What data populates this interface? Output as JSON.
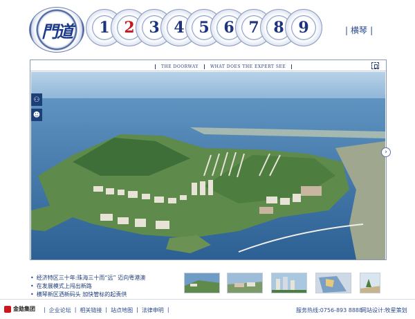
{
  "header": {
    "logo_text": "門道",
    "chapters": [
      "1",
      "2",
      "3",
      "4",
      "5",
      "6",
      "7",
      "8",
      "9"
    ],
    "active_chapter": "2",
    "link_label": "横琴",
    "link_separator": "|"
  },
  "viewer": {
    "title_left": "THE DOORWAY",
    "title_right": "WHAT DOES THE EXPERT SEE",
    "side_icons": [
      "person-walking-icon",
      "person-icon"
    ],
    "next_icon": "chevron-right-icon",
    "expand_icon": "expand-icon"
  },
  "news": [
    "经济特区三十年:珠海三十而“远” 迈向粤港澳",
    "在发展模式上闯出新路",
    "横琴新区洒新码头 加快管标的起责供"
  ],
  "footer": {
    "brand_name": "金勋集团",
    "nav": [
      "企业论坛",
      "相关链接",
      "站点地图",
      "法律申明"
    ],
    "hotline": "服务热线:0756-893 8888",
    "design": "网站设计:牧星策划"
  },
  "colors": {
    "brand_blue": "#1c3380",
    "active_red": "#c8171d",
    "brand_red": "#c8171d"
  }
}
